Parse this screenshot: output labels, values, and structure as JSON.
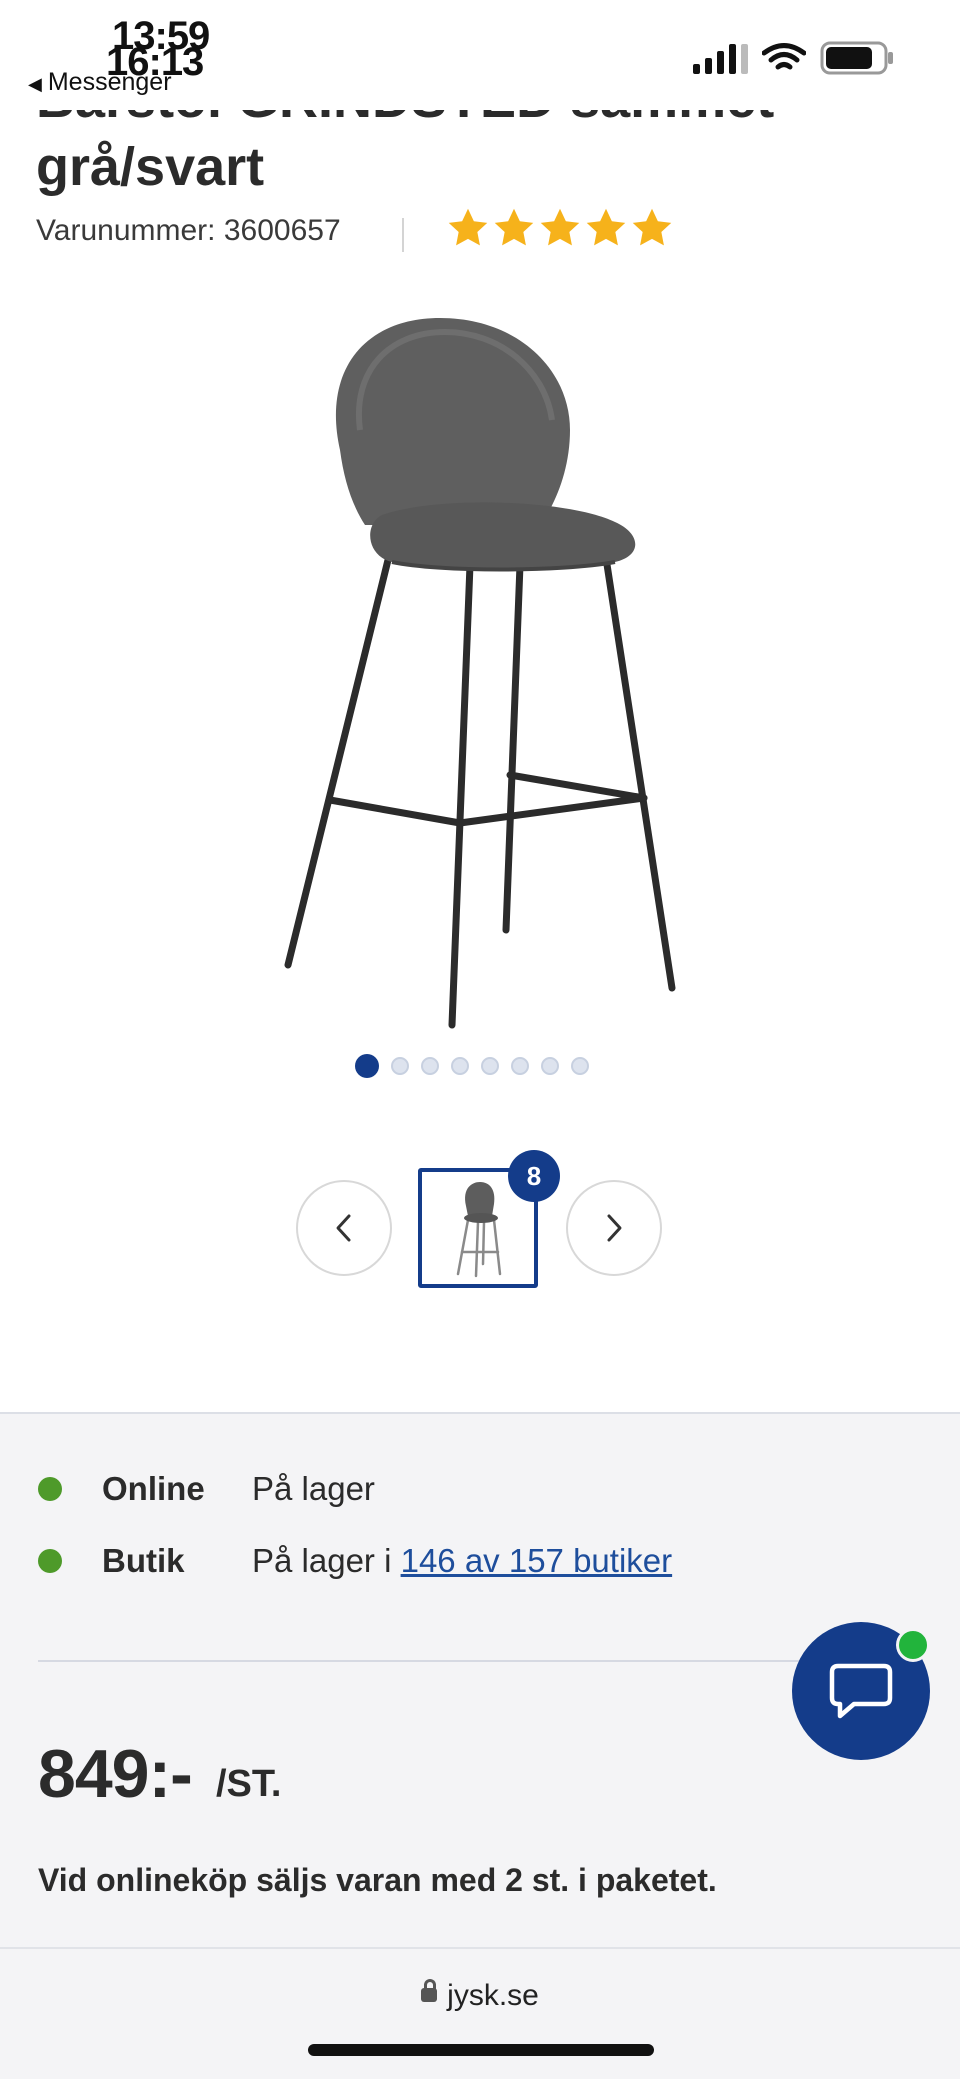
{
  "status_bar": {
    "time_overlap_1": "13:59",
    "time_overlap_2": "16:13",
    "back_app": "Messenger"
  },
  "product": {
    "title_line_1": "Barstol GRINDSTED sammet",
    "title_line_2": "grå/svart",
    "sku_label": "Varunummer: 3600657",
    "rating_stars": 5,
    "image_count": 8,
    "gallery_dots_total": 8,
    "gallery_dot_active": 1
  },
  "availability": {
    "online_label": "Online",
    "online_status": "På lager",
    "store_label": "Butik",
    "store_status_prefix": "På lager i",
    "store_link": "146 av 157 butiker"
  },
  "price": {
    "amount": "849:-",
    "unit": "/ST.",
    "note": "Vid onlineköp säljs varan med 2 st. i paketet."
  },
  "browser": {
    "domain": "jysk.se"
  },
  "colors": {
    "brand_blue": "#143c8a",
    "star_yellow": "#f6b21b",
    "stock_green": "#4e9a2a",
    "chat_online_green": "#22b43c"
  }
}
